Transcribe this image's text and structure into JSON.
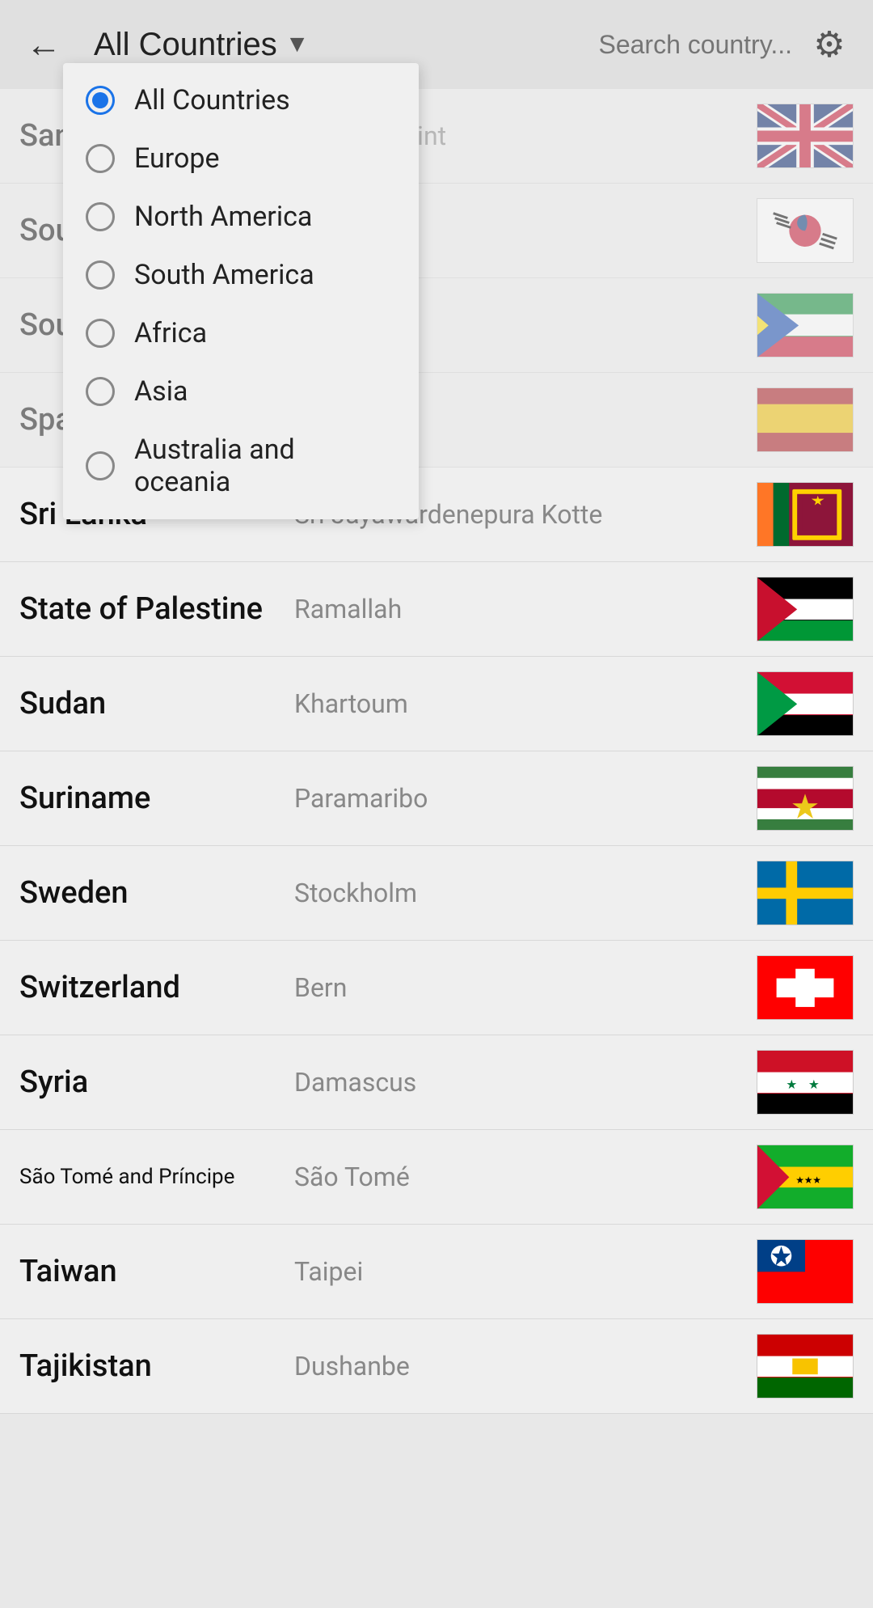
{
  "header": {
    "back_label": "←",
    "title": "All Countries",
    "dropdown_arrow": "▼",
    "search_placeholder": "Search country...",
    "settings_icon": "⚙"
  },
  "dropdown": {
    "items": [
      {
        "id": "all",
        "label": "All Countries",
        "selected": true
      },
      {
        "id": "europe",
        "label": "Europe",
        "selected": false
      },
      {
        "id": "north-america",
        "label": "North America",
        "selected": false
      },
      {
        "id": "south-america",
        "label": "South America",
        "selected": false
      },
      {
        "id": "africa",
        "label": "Africa",
        "selected": false
      },
      {
        "id": "asia",
        "label": "Asia",
        "selected": false
      },
      {
        "id": "australia",
        "label": "Australia and oceania",
        "selected": false
      }
    ]
  },
  "countries": [
    {
      "name": "Sandw...",
      "capital": "Edward Point",
      "nameSmall": false,
      "flag_id": "sandwich"
    },
    {
      "name": "Sou...",
      "capital": "",
      "nameSmall": false,
      "flag_id": "south_korea"
    },
    {
      "name": "Sou...",
      "capital": "",
      "nameSmall": false,
      "flag_id": "south_sudan"
    },
    {
      "name": "Spa...",
      "capital": "...d",
      "nameSmall": false,
      "flag_id": "spain"
    },
    {
      "name": "Sri Lanka",
      "capital": "Sri Jayawardenepura Kotte",
      "nameSmall": false,
      "flag_id": "sri_lanka"
    },
    {
      "name": "State of Palestine",
      "capital": "Ramallah",
      "nameSmall": false,
      "flag_id": "palestine"
    },
    {
      "name": "Sudan",
      "capital": "Khartoum",
      "nameSmall": false,
      "flag_id": "sudan"
    },
    {
      "name": "Suriname",
      "capital": "Paramaribo",
      "nameSmall": false,
      "flag_id": "suriname"
    },
    {
      "name": "Sweden",
      "capital": "Stockholm",
      "nameSmall": false,
      "flag_id": "sweden"
    },
    {
      "name": "Switzerland",
      "capital": "Bern",
      "nameSmall": false,
      "flag_id": "switzerland"
    },
    {
      "name": "Syria",
      "capital": "Damascus",
      "nameSmall": false,
      "flag_id": "syria"
    },
    {
      "name": "São Tomé and Príncipe",
      "capital": "São Tomé",
      "nameSmall": true,
      "flag_id": "sao_tome"
    },
    {
      "name": "Taiwan",
      "capital": "Taipei",
      "nameSmall": false,
      "flag_id": "taiwan"
    },
    {
      "name": "Tajikistan",
      "capital": "Dushanbe",
      "nameSmall": false,
      "flag_id": "tajikistan"
    }
  ]
}
